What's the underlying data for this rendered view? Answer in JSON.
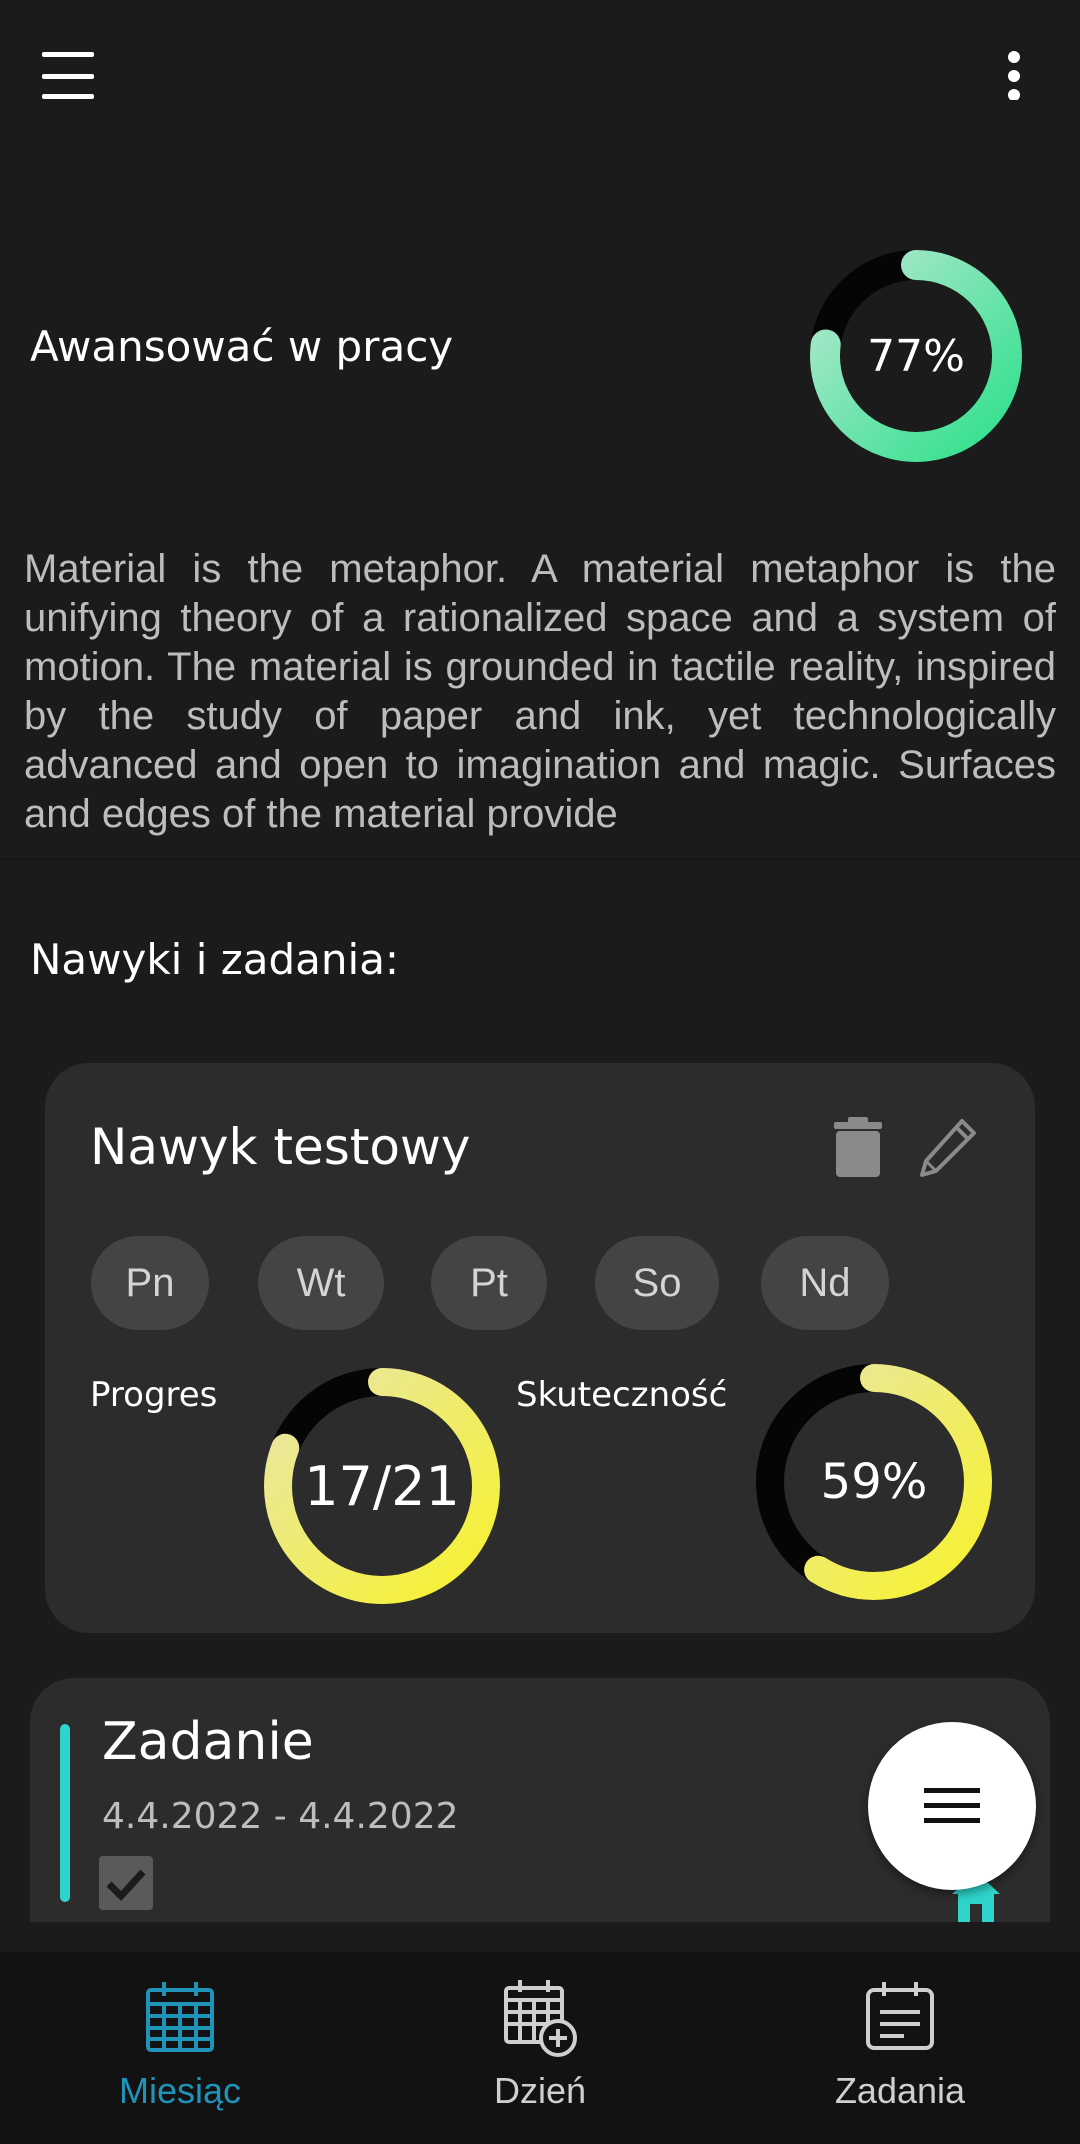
{
  "goal": {
    "title": "Awansować w pracy",
    "progress_percent": 77,
    "progress_label": "77%",
    "description": "Material is the metaphor. A material metaphor is the unifying theory of a rationalized space and a system of motion. The material is grounded in tactile reality, inspired by the study of paper and ink, yet technologically advanced and open to imagination and magic. Surfaces and edges of the material provide"
  },
  "section": {
    "title": "Nawyki i zadania:"
  },
  "habit": {
    "name": "Nawyk testowy",
    "days": [
      "Pn",
      "Wt",
      "Pt",
      "So",
      "Nd"
    ],
    "progress": {
      "label": "Progres",
      "value_label": "17/21",
      "done": 17,
      "total": 21
    },
    "effectiveness": {
      "label": "Skuteczność",
      "value_label": "59%",
      "percent": 59
    }
  },
  "task": {
    "title": "Zadanie",
    "dates": "4.4.2022 - 4.4.2022",
    "completed": true
  },
  "nav": {
    "items": [
      {
        "label": "Miesiąc",
        "icon": "calendar-month-icon",
        "active": true
      },
      {
        "label": "Dzień",
        "icon": "calendar-add-icon",
        "active": false
      },
      {
        "label": "Zadania",
        "icon": "task-list-icon",
        "active": false
      }
    ]
  },
  "colors": {
    "background": "#1b1b1b",
    "card": "#2c2c2c",
    "goal_ring_start": "#2ee08c",
    "goal_ring_end": "#a8e6c8",
    "habit_ring_start": "#f7f22e",
    "habit_ring_end": "#e8e6a4",
    "task_accent": "#2fd5cc",
    "nav_active": "#1f93b8"
  }
}
